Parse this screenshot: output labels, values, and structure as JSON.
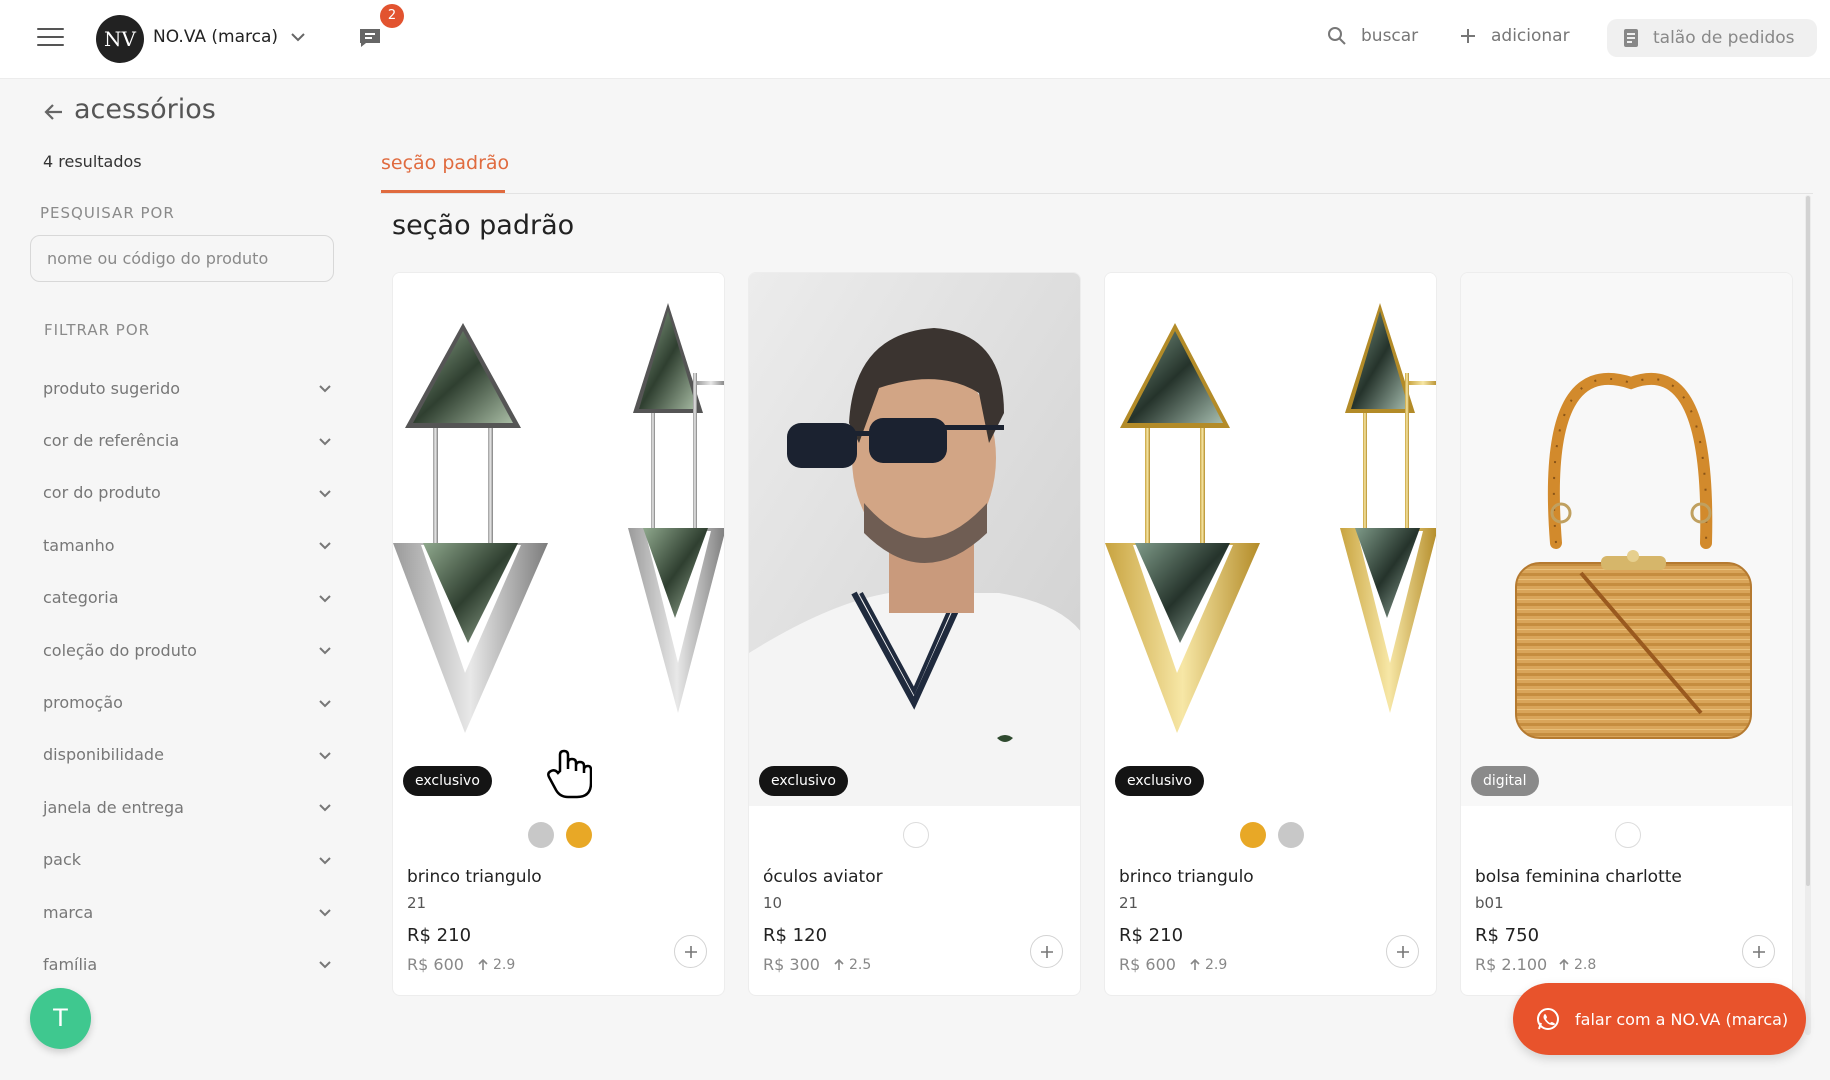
{
  "header": {
    "brand_logo_text": "NV",
    "brand_name": "NO.VA (marca)",
    "chat_badge_count": "2",
    "search_label": "buscar",
    "add_label": "adicionar",
    "orders_label": "talão de pedidos"
  },
  "sidebar": {
    "title": "acessórios",
    "results": "4 resultados",
    "search_section_label": "PESQUISAR POR",
    "search_placeholder": "nome ou código do produto",
    "filter_section_label": "FILTRAR POR",
    "filters": [
      {
        "label": "produto sugerido"
      },
      {
        "label": "cor de referência"
      },
      {
        "label": "cor do produto"
      },
      {
        "label": "tamanho"
      },
      {
        "label": "categoria"
      },
      {
        "label": "coleção do produto"
      },
      {
        "label": "promoção"
      },
      {
        "label": "disponibilidade"
      },
      {
        "label": "janela de entrega"
      },
      {
        "label": "pack"
      },
      {
        "label": "marca"
      },
      {
        "label": "família"
      }
    ],
    "avatar_initial": "T"
  },
  "main": {
    "tab_label": "seção padrão",
    "section_title": "seção padrão",
    "products": [
      {
        "tag": "exclusivo",
        "name": "brinco triangulo",
        "code": "21",
        "price": "R$ 210",
        "old_price": "R$ 600",
        "markup": "2.9",
        "swatches": [
          "#c8c8c8",
          "#e8a826"
        ]
      },
      {
        "tag": "exclusivo",
        "name": "óculos aviator",
        "code": "10",
        "price": "R$ 120",
        "old_price": "R$ 300",
        "markup": "2.5",
        "swatches": [
          "#ffffff"
        ]
      },
      {
        "tag": "exclusivo",
        "name": "brinco triangulo",
        "code": "21",
        "price": "R$ 210",
        "old_price": "R$ 600",
        "markup": "2.9",
        "swatches": [
          "#e8a826",
          "#c8c8c8"
        ]
      },
      {
        "tag": "digital",
        "name": "bolsa feminina charlotte",
        "code": "b01",
        "price": "R$ 750",
        "old_price": "R$ 2.100",
        "markup": "2.8",
        "swatches": [
          "#ffffff"
        ]
      }
    ],
    "chat_button_label": "falar com a NO.VA (marca)"
  },
  "colors": {
    "accent": "#e06b3f",
    "chat_fab": "#e8532c",
    "avatar": "#3fc88f",
    "badge": "#e2532f"
  }
}
